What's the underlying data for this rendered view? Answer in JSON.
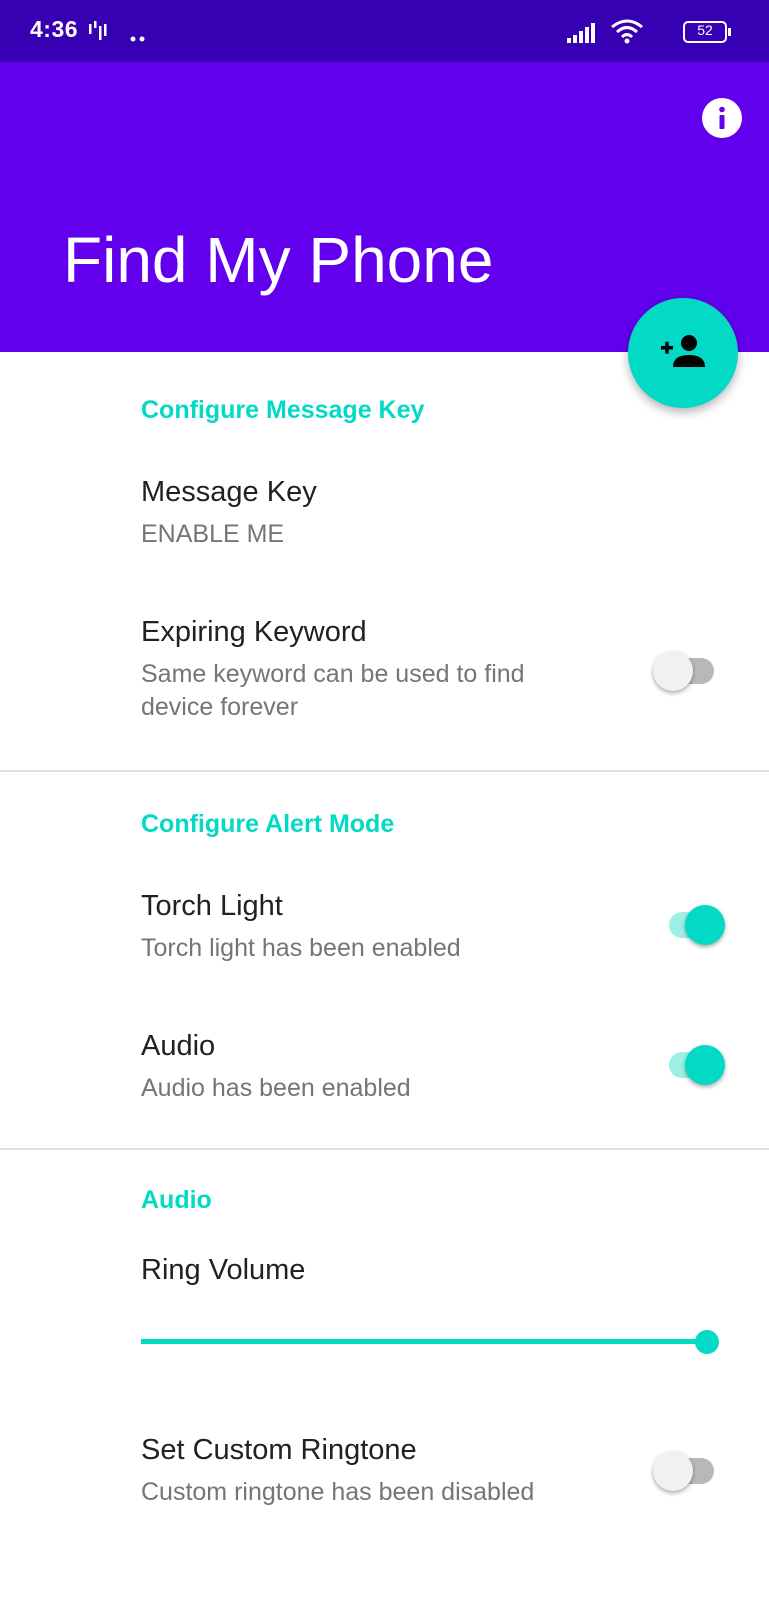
{
  "status_bar": {
    "time": "4:36",
    "battery": "52"
  },
  "app_bar": {
    "title": "Find My Phone"
  },
  "colors": {
    "primary": "#6200ee",
    "primary_dark": "#3700b3",
    "accent": "#03dac5"
  },
  "sections": {
    "message_key": {
      "header": "Configure Message Key",
      "message_key_title": "Message Key",
      "message_key_summary": "ENABLE ME",
      "expiring_title": "Expiring Keyword",
      "expiring_summary": "Same keyword can be used to find device forever",
      "expiring_enabled": false
    },
    "alert_mode": {
      "header": "Configure Alert Mode",
      "torch_title": "Torch Light",
      "torch_summary": "Torch light has been enabled",
      "torch_enabled": true,
      "audio_title": "Audio",
      "audio_summary": "Audio has been enabled",
      "audio_enabled": true
    },
    "audio": {
      "header": "Audio",
      "ring_volume_title": "Ring Volume",
      "ring_volume_level": 1.0,
      "ringtone_title": "Set Custom Ringtone",
      "ringtone_summary": "Custom ringtone has been disabled",
      "ringtone_enabled": false
    }
  }
}
